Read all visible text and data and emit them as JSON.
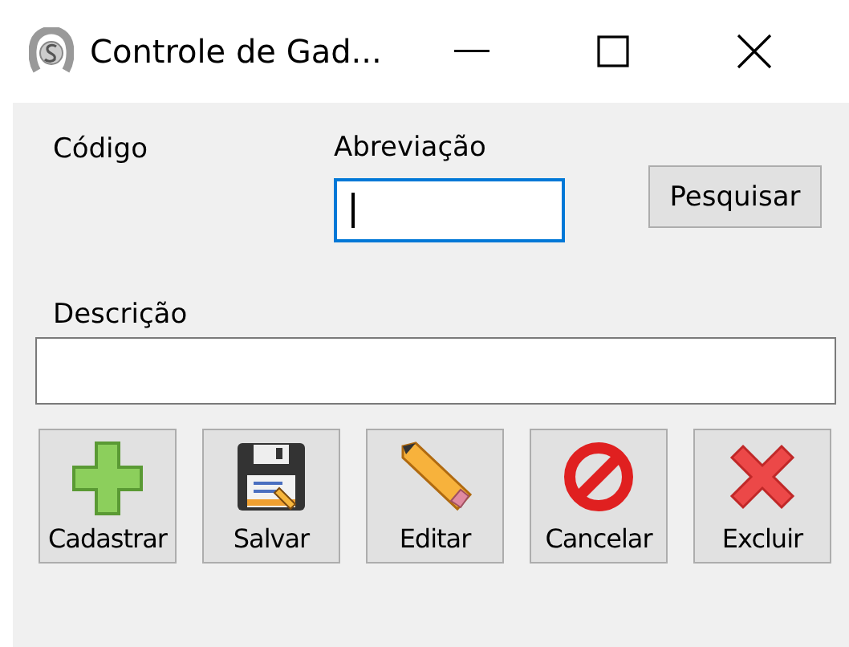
{
  "window": {
    "title": "Controle de Gad..."
  },
  "fields": [
    {
      "label": "Código"
    },
    {
      "label": "Abreviação",
      "focused": true
    },
    {
      "label": "Descrição",
      "focused": false
    }
  ],
  "search_button": {
    "label": "Pesquisar"
  },
  "toolbar": [
    {
      "kind": "add",
      "label": "Cadastrar"
    },
    {
      "kind": "save",
      "label": "Salvar"
    },
    {
      "kind": "edit",
      "label": "Editar"
    },
    {
      "kind": "cancel",
      "label": "Cancelar"
    },
    {
      "kind": "delete",
      "label": "Excluir"
    }
  ]
}
